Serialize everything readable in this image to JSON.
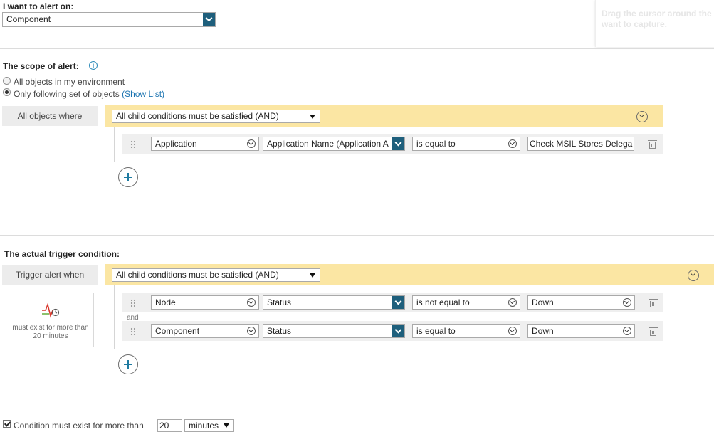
{
  "alert_on": {
    "label": "I want to alert on:",
    "value": "Component"
  },
  "tooltip": {
    "line1": "Drag the cursor around the",
    "line2": "want to capture."
  },
  "scope": {
    "title": "The scope of alert:",
    "options": [
      {
        "label": "All objects in my environment",
        "selected": false
      },
      {
        "label": "Only following set of objects",
        "selected": true
      }
    ],
    "show_list": "(Show List)",
    "where_label": "All objects where",
    "group_select": "All child conditions must be satisfied (AND)",
    "condition": {
      "field": "Application",
      "property": "Application Name (Application A",
      "operator": "is equal to",
      "value": "Check MSIL Stores Delega"
    }
  },
  "trigger": {
    "title": "The actual trigger condition:",
    "when_label": "Trigger alert when",
    "group_select": "All child conditions must be satisfied (AND)",
    "badge_text": "must exist for more than 20 minutes",
    "and_label": "and",
    "conditions": [
      {
        "field": "Node",
        "property": "Status",
        "operator": "is not equal to",
        "value": "Down"
      },
      {
        "field": "Component",
        "property": "Status",
        "operator": "is equal to",
        "value": "Down"
      }
    ]
  },
  "duration": {
    "checked": true,
    "label": "Condition must exist for more than",
    "amount": "20",
    "unit": "minutes"
  }
}
